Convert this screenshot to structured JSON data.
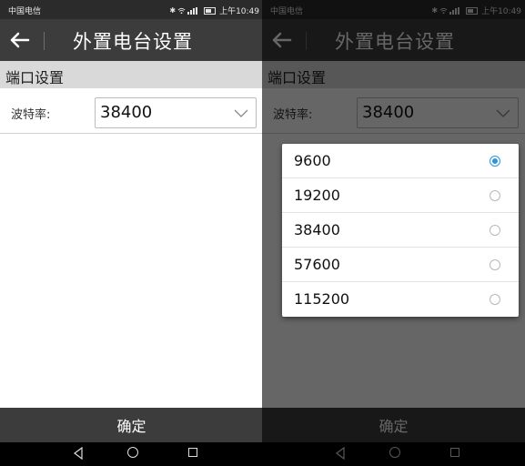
{
  "status_bar": {
    "carrier": "中国电信",
    "icons": [
      "bluetooth-icon",
      "wifi-icon",
      "signal-icon",
      "battery-icon"
    ],
    "time": "上午10:49"
  },
  "app_bar": {
    "back_icon": "arrow-left-icon",
    "title": "外置电台设置"
  },
  "section": {
    "title": "端口设置"
  },
  "baud_field": {
    "label": "波特率:",
    "value": "38400",
    "arrow_icon": "chevron-down-icon"
  },
  "confirm_button": {
    "label": "确定"
  },
  "nav_bar": {
    "icons": [
      "nav-back-icon",
      "nav-home-icon",
      "nav-recents-icon"
    ]
  },
  "baud_dialog": {
    "options": [
      "9600",
      "19200",
      "38400",
      "57600",
      "115200"
    ],
    "selected_index": 0
  },
  "colors": {
    "app_bar": "#3c3c3c",
    "section_header": "#d9d9d9",
    "radio_selected": "#2d95df"
  }
}
